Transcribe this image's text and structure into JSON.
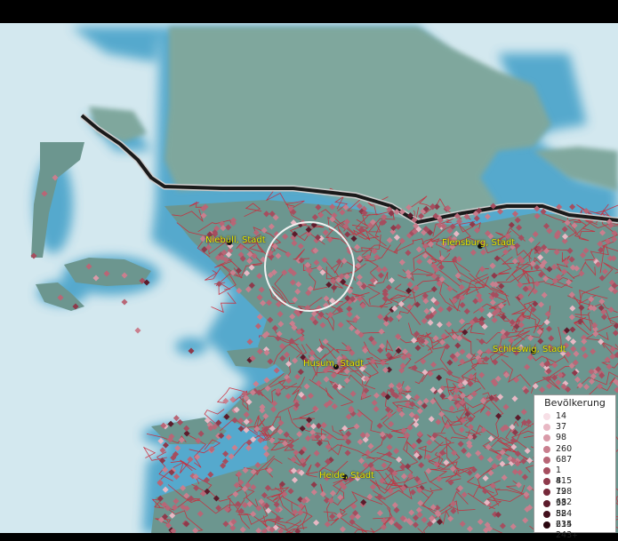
{
  "legend": {
    "title": "Bevölkerung",
    "items": [
      {
        "label": "14",
        "color": "#f7dfe6"
      },
      {
        "label": "37",
        "color": "#e8b8c4"
      },
      {
        "label": "98",
        "color": "#d99aa8"
      },
      {
        "label": "260",
        "color": "#c97f8e"
      },
      {
        "label": "687",
        "color": "#b86676"
      },
      {
        "label": "1 815",
        "color": "#a54e5f"
      },
      {
        "label": "4 798",
        "color": "#8e3a4b"
      },
      {
        "label": "12 682",
        "color": "#76293a"
      },
      {
        "label": "33 524",
        "color": "#5c1b2b"
      },
      {
        "label": "88 615",
        "color": "#43101d"
      },
      {
        "label": "234 243",
        "color": "#2a0610"
      }
    ],
    "overflow_mark": "+"
  },
  "cities": [
    {
      "name": "Niebüll, Stadt"
    },
    {
      "name": "Flensburg, Stadt"
    },
    {
      "name": "Husum, Stadt"
    },
    {
      "name": "Schleswig, Stadt"
    },
    {
      "name": "Heide, Stadt"
    }
  ],
  "colors": {
    "sea": "#cfe6ee",
    "land": "#6f9a94",
    "denmark": "#7da59c",
    "border": "#1a1a1a",
    "municipality_lines": "#cc2a3a",
    "label": "#e8e800"
  }
}
